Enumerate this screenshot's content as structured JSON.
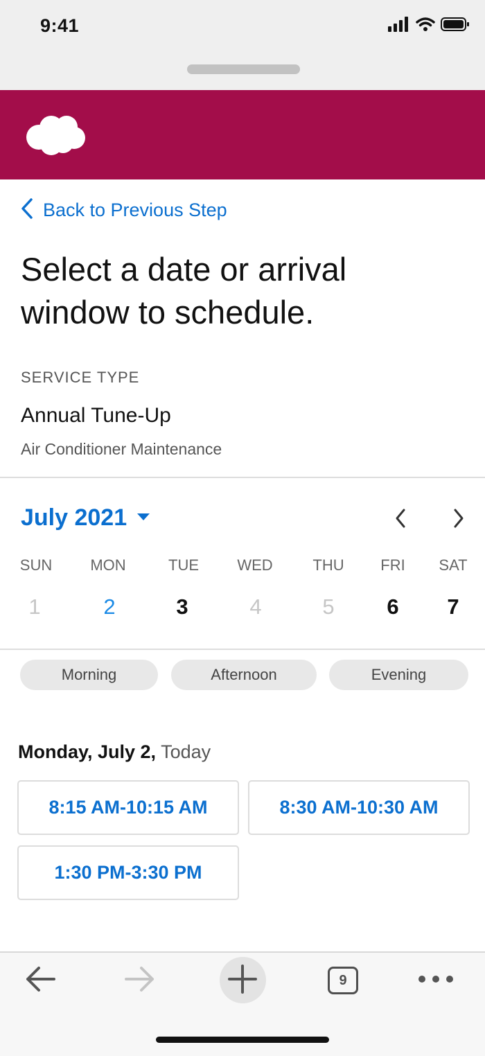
{
  "status_bar": {
    "time": "9:41",
    "icons": [
      "signal-icon",
      "wifi-icon",
      "battery-icon"
    ]
  },
  "brand": {
    "logo": "salesforce-cloud-logo",
    "color": "#a30d4a"
  },
  "back_link": {
    "label": "Back to Previous Step"
  },
  "title": "Select a date or arrival window to schedule.",
  "service": {
    "label": "SERVICE TYPE",
    "name": "Annual Tune-Up",
    "description": "Air Conditioner Maintenance"
  },
  "calendar": {
    "month_label": "July 2021",
    "weekdays": [
      "SUN",
      "MON",
      "TUE",
      "WED",
      "THU",
      "FRI",
      "SAT"
    ],
    "days": [
      {
        "num": "1",
        "state": "disabled"
      },
      {
        "num": "2",
        "state": "selected"
      },
      {
        "num": "3",
        "state": "available"
      },
      {
        "num": "4",
        "state": "disabled"
      },
      {
        "num": "5",
        "state": "disabled"
      },
      {
        "num": "6",
        "state": "available"
      },
      {
        "num": "7",
        "state": "available"
      }
    ]
  },
  "filters": [
    "Morning",
    "Afternoon",
    "Evening"
  ],
  "selected_day": {
    "date": "Monday, July 2,",
    "relative": "Today"
  },
  "slots": [
    "8:15 AM-10:15 AM",
    "8:30 AM-10:30 AM",
    "1:30 PM-3:30 PM"
  ],
  "browser_toolbar": {
    "tab_count": "9"
  },
  "colors": {
    "accent": "#0b6fcf",
    "selected_day": "#1a8ae6"
  }
}
